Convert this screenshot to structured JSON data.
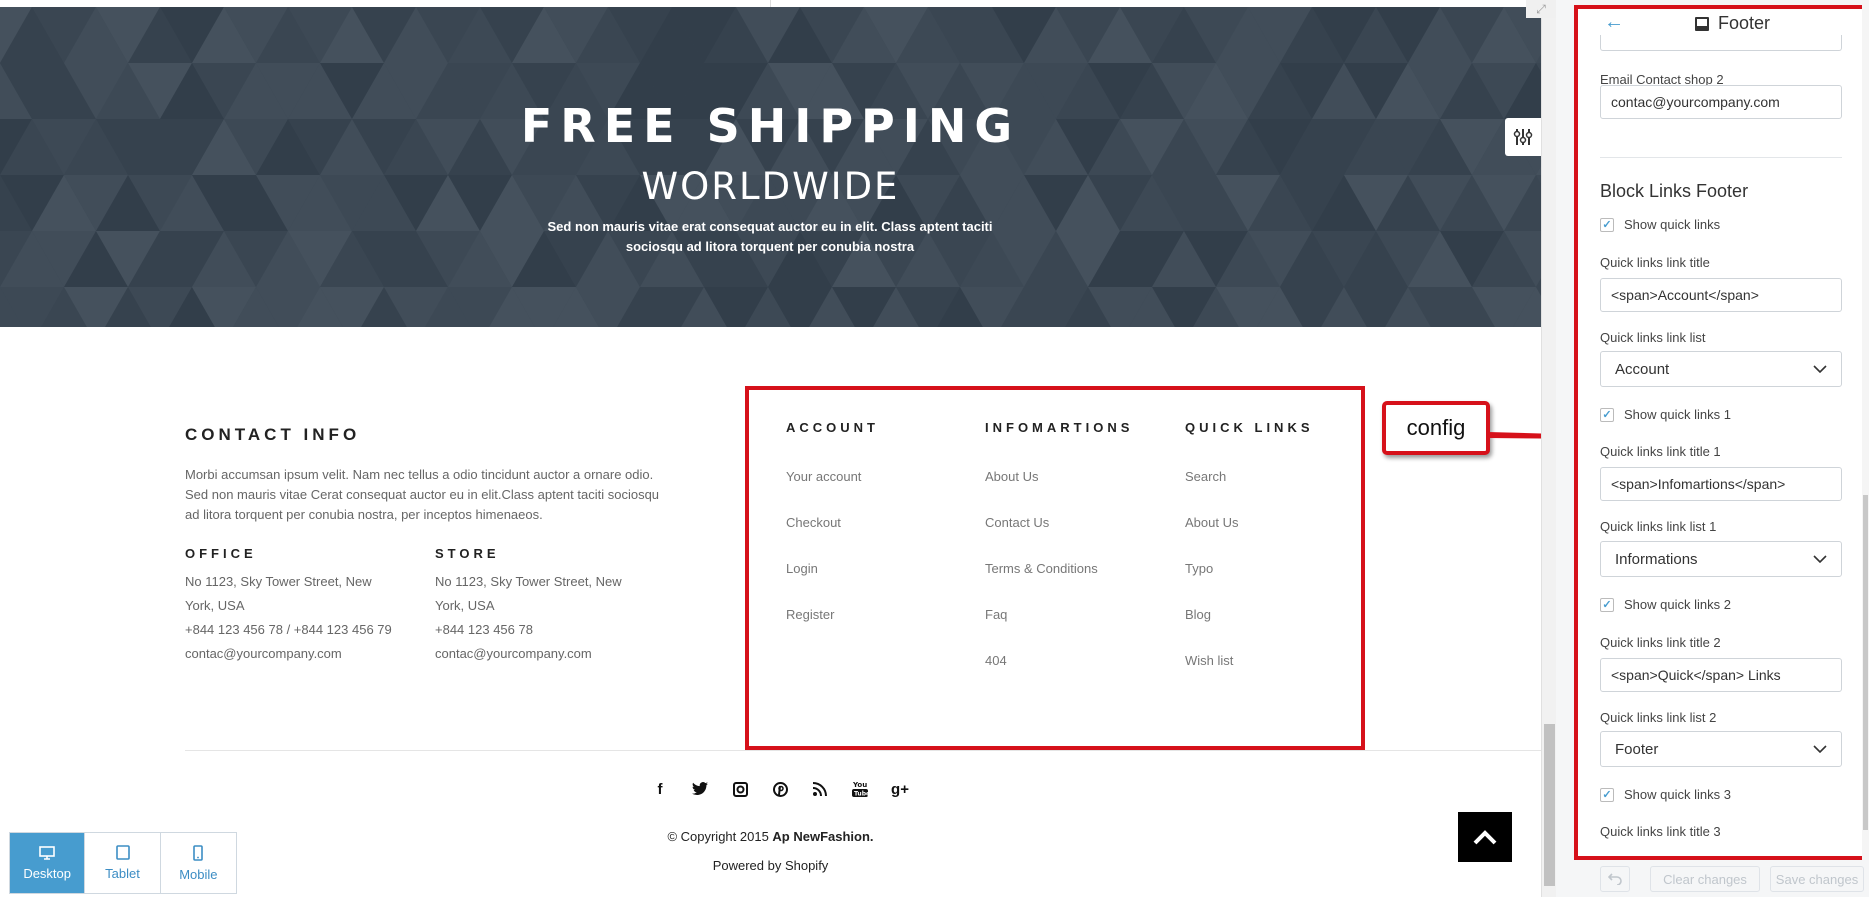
{
  "banner": {
    "title": "FREE SHIPPING",
    "subtitle": "WORLDWIDE",
    "description": "Sed non mauris vitae erat consequat auctor eu in elit. Class aptent taciti sociosqu ad litora torquent per conubia nostra"
  },
  "contact": {
    "title": "CONTACT INFO",
    "description": "Morbi accumsan ipsum velit. Nam nec tellus a odio tincidunt auctor a ornare odio. Sed non mauris vitae Cerat consequat auctor eu in elit.Class aptent taciti sociosqu ad litora torquent per conubia nostra, per inceptos himenaeos.",
    "office": {
      "title": "OFFICE",
      "lines": [
        "No 1123, Sky Tower Street, New",
        "York, USA",
        "+844 123 456 78 / +844 123 456 79",
        "contac@yourcompany.com"
      ]
    },
    "store": {
      "title": "STORE",
      "lines": [
        "No 1123, Sky Tower Street, New",
        "York, USA",
        "+844 123 456 78",
        "contac@yourcompany.com"
      ]
    }
  },
  "footer_links": {
    "account": {
      "title": "ACCOUNT",
      "items": [
        "Your account",
        "Checkout",
        "Login",
        "Register"
      ]
    },
    "info": {
      "title": "INFOMARTIONS",
      "items": [
        "About Us",
        "Contact Us",
        "Terms & Conditions",
        "Faq",
        "404"
      ]
    },
    "quick": {
      "title": "QUICK LINKS",
      "items": [
        "Search",
        "About Us",
        "Typo",
        "Blog",
        "Wish list"
      ]
    }
  },
  "callout": {
    "label": "config"
  },
  "socials": [
    "facebook-icon",
    "twitter-icon",
    "instagram-icon",
    "pinterest-icon",
    "rss-icon",
    "youtube-icon",
    "google-plus-icon"
  ],
  "copyright": {
    "prefix": "© Copyright 2015 ",
    "brand": "Ap NewFashion."
  },
  "powered": "Powered by Shopify",
  "devices": [
    {
      "label": "Desktop",
      "icon": "desktop-icon",
      "active": true
    },
    {
      "label": "Tablet",
      "icon": "tablet-icon",
      "active": false
    },
    {
      "label": "Mobile",
      "icon": "mobile-icon",
      "active": false
    }
  ],
  "sidebar": {
    "title": "Footer",
    "email_label": "Email Contact shop 2",
    "email_value": "contac@yourcompany.com",
    "section_title": "Block Links Footer",
    "show_quick_links": "Show quick links",
    "ql_title_label": "Quick links link title",
    "ql_title_value": "<span>Account</span>",
    "ql_list_label": "Quick links link list",
    "ql_list_value": "Account",
    "show_quick_links_1": "Show quick links 1",
    "ql_title_1_label": "Quick links link title 1",
    "ql_title_1_value": "<span>Infomartions</span>",
    "ql_list_1_label": "Quick links link list 1",
    "ql_list_1_value": "Informations",
    "show_quick_links_2": "Show quick links 2",
    "ql_title_2_label": "Quick links link title 2",
    "ql_title_2_value": "<span>Quick</span> Links",
    "ql_list_2_label": "Quick links link list 2",
    "ql_list_2_value": "Footer",
    "show_quick_links_3": "Show quick links 3",
    "ql_title_3_label": "Quick links link title 3",
    "clear_label": "Clear changes",
    "save_label": "Save changes"
  },
  "colors": {
    "accent": "#479ccf",
    "highlight": "#d6111a",
    "banner": "#3d4955"
  }
}
